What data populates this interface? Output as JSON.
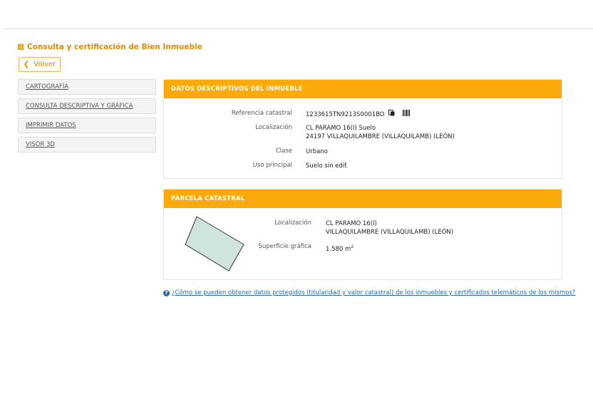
{
  "page": {
    "title": "Consulta y certificación de Bien Inmueble",
    "back_label": "Volver"
  },
  "sidebar": {
    "items": [
      {
        "label": "CARTOGRAFÍA"
      },
      {
        "label": "CONSULTA DESCRIPTIVA Y GRÁFICA"
      },
      {
        "label": "IMPRIMIR DATOS"
      },
      {
        "label": "VISOR 3D"
      }
    ]
  },
  "datos": {
    "header": "DATOS DESCRIPTIVOS DEL INMUEBLE",
    "ref_label": "Referencia catastral",
    "ref_value": "1233615TN9213S0001BO",
    "loc_label": "Localización",
    "loc_line1": "CL PARAMO 16(I) Suelo",
    "loc_line2": "24197 VILLAQUILAMBRE (VILLAQUILAMB) (LEÓN)",
    "clase_label": "Clase",
    "clase_value": "Urbano",
    "uso_label": "Uso principal",
    "uso_value": "Suelo sin edif."
  },
  "parcela": {
    "header": "PARCELA CATASTRAL",
    "loc_label": "Localización",
    "loc_line1": "CL PARAMO 16(I)",
    "loc_line2": "VILLAQUILAMBRE (VILLAQUILAMB) (LEÓN)",
    "sup_label": "Superficie gráfica",
    "sup_value": "1.580 m",
    "sup_unit_sup": "2"
  },
  "help_link": "¿Cómo se pueden obtener datos protegidos (titularidad y valor catastral) de los inmuebles y certificados telemáticos de los mismos?",
  "colors": {
    "accent": "#fbaa0a",
    "title": "#e08a00",
    "link": "#2a6aa8",
    "parcel_fill": "#cfe5dc"
  }
}
